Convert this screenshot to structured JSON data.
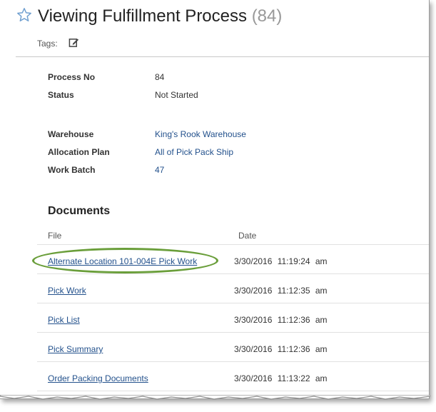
{
  "page": {
    "title": "Viewing Fulfillment Process",
    "count": "(84)",
    "tags_label": "Tags:"
  },
  "details": {
    "process_no_label": "Process No",
    "process_no_value": "84",
    "status_label": "Status",
    "status_value": "Not Started",
    "warehouse_label": "Warehouse",
    "warehouse_value": "King's Rook Warehouse",
    "allocation_plan_label": "Allocation Plan",
    "allocation_plan_value": "All of Pick Pack Ship",
    "work_batch_label": "Work Batch",
    "work_batch_value": "47"
  },
  "documents": {
    "heading": "Documents",
    "col_file": "File",
    "col_date": "Date",
    "rows": [
      {
        "file": "Alternate Location 101-004E Pick Work",
        "date": "3/30/2016 11:19:24 am"
      },
      {
        "file": "Pick Work",
        "date": "3/30/2016 11:12:35 am"
      },
      {
        "file": "Pick List",
        "date": "3/30/2016 11:12:36 am"
      },
      {
        "file": "Pick Summary",
        "date": "3/30/2016 11:12:36 am"
      },
      {
        "file": "Order Packing Documents",
        "date": "3/30/2016 11:13:22 am"
      }
    ]
  },
  "icons": {
    "favorite": "star-icon",
    "edit_tags": "edit-icon"
  },
  "colors": {
    "link": "#23518c",
    "star": "#6f9fd0",
    "highlight": "#6a9e3a"
  }
}
